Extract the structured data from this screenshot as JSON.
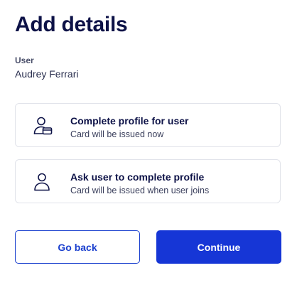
{
  "header": {
    "title": "Add details"
  },
  "user": {
    "label": "User",
    "name": "Audrey Ferrari"
  },
  "options": [
    {
      "title": "Complete profile for user",
      "description": "Card will be issued now",
      "icon": "user-card-icon"
    },
    {
      "title": "Ask user to complete profile",
      "description": "Card will be issued when user joins",
      "icon": "user-icon"
    }
  ],
  "actions": {
    "back_label": "Go back",
    "continue_label": "Continue"
  },
  "colors": {
    "heading": "#0d1247",
    "primary": "#1636d6",
    "border": "#e1e3ea"
  }
}
